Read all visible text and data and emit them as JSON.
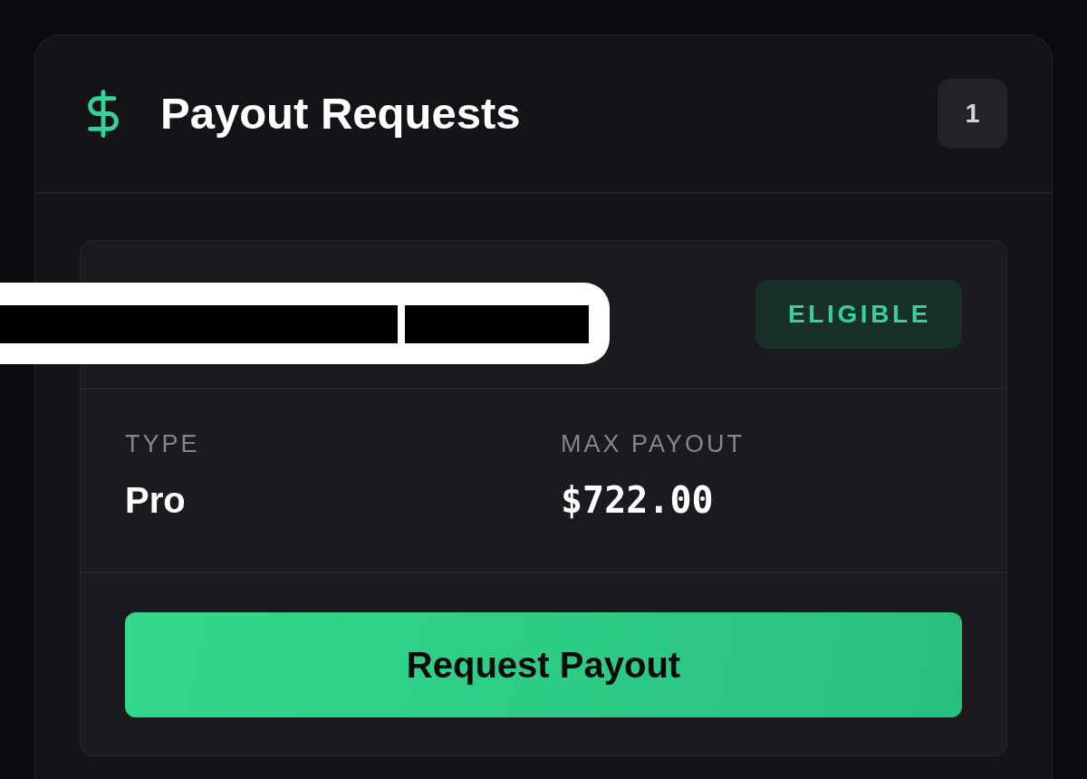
{
  "panel": {
    "title": "Payout Requests",
    "count": "1"
  },
  "requests": [
    {
      "redacted": true,
      "status": {
        "label": "ELIGIBLE",
        "kind": "eligible"
      },
      "fields": [
        {
          "label": "TYPE",
          "value": "Pro",
          "kind": "text"
        },
        {
          "label": "MAX PAYOUT",
          "value": "$722.00",
          "kind": "money"
        }
      ],
      "action": "Request Payout"
    }
  ]
}
